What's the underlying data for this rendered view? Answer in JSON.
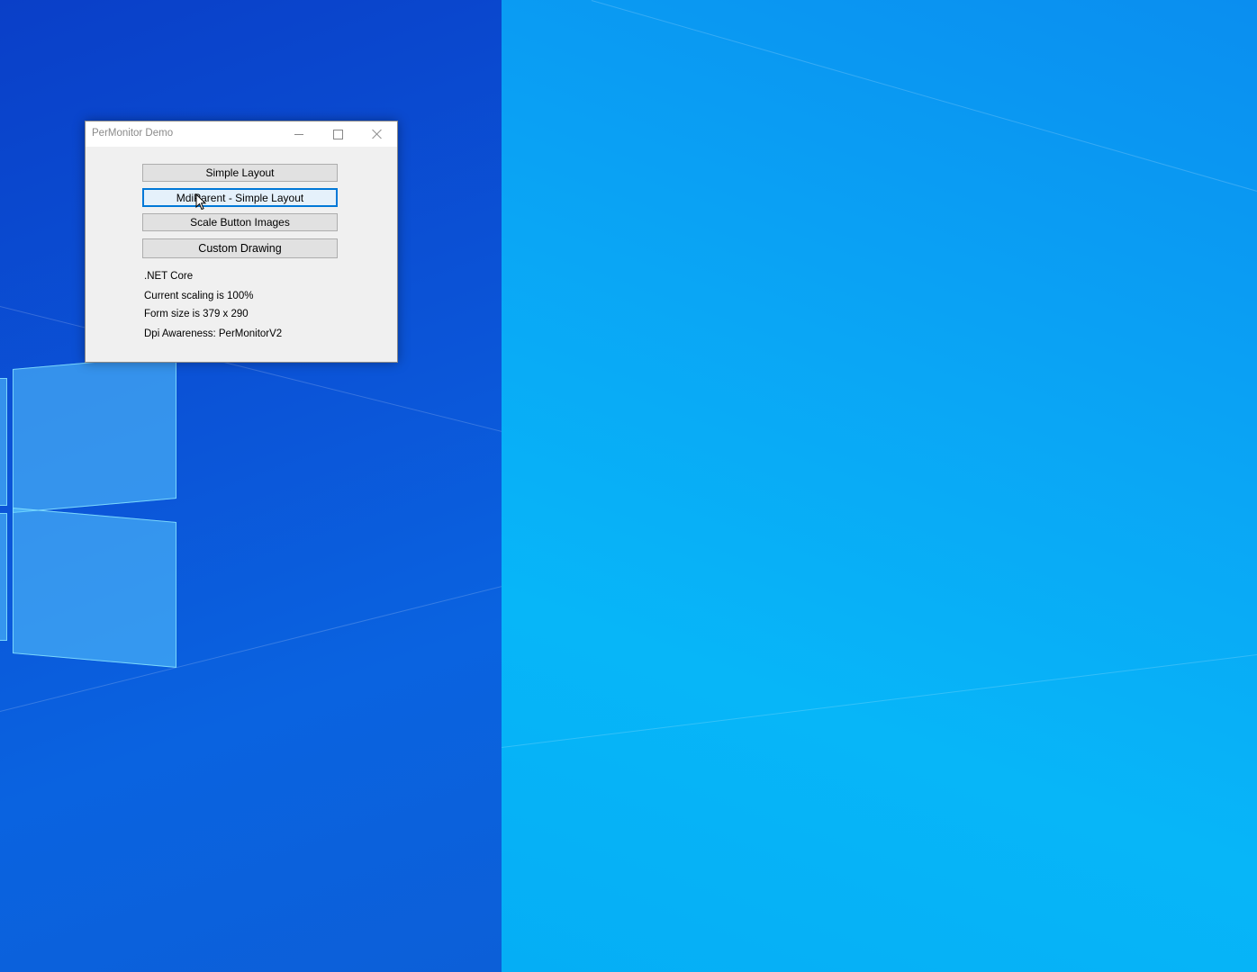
{
  "window": {
    "title": "PerMonitor Demo"
  },
  "buttons": {
    "simple_layout": "Simple Layout",
    "mdi_parent": "MdiParent - Simple Layout",
    "scale_button_images": "Scale Button Images",
    "custom_drawing": "Custom Drawing"
  },
  "info": {
    "runtime": ".NET Core",
    "scaling": "Current scaling is 100%",
    "form_size": "Form size is 379 x 290",
    "dpi_awareness": "Dpi Awareness: PerMonitorV2"
  },
  "colors": {
    "focus_border": "#0078d7",
    "desktop_left": "#0b55d8",
    "desktop_right": "#07b6f8"
  },
  "icons": [
    "minimize-icon",
    "maximize-icon",
    "close-icon",
    "mouse-cursor-icon",
    "windows-logo"
  ]
}
